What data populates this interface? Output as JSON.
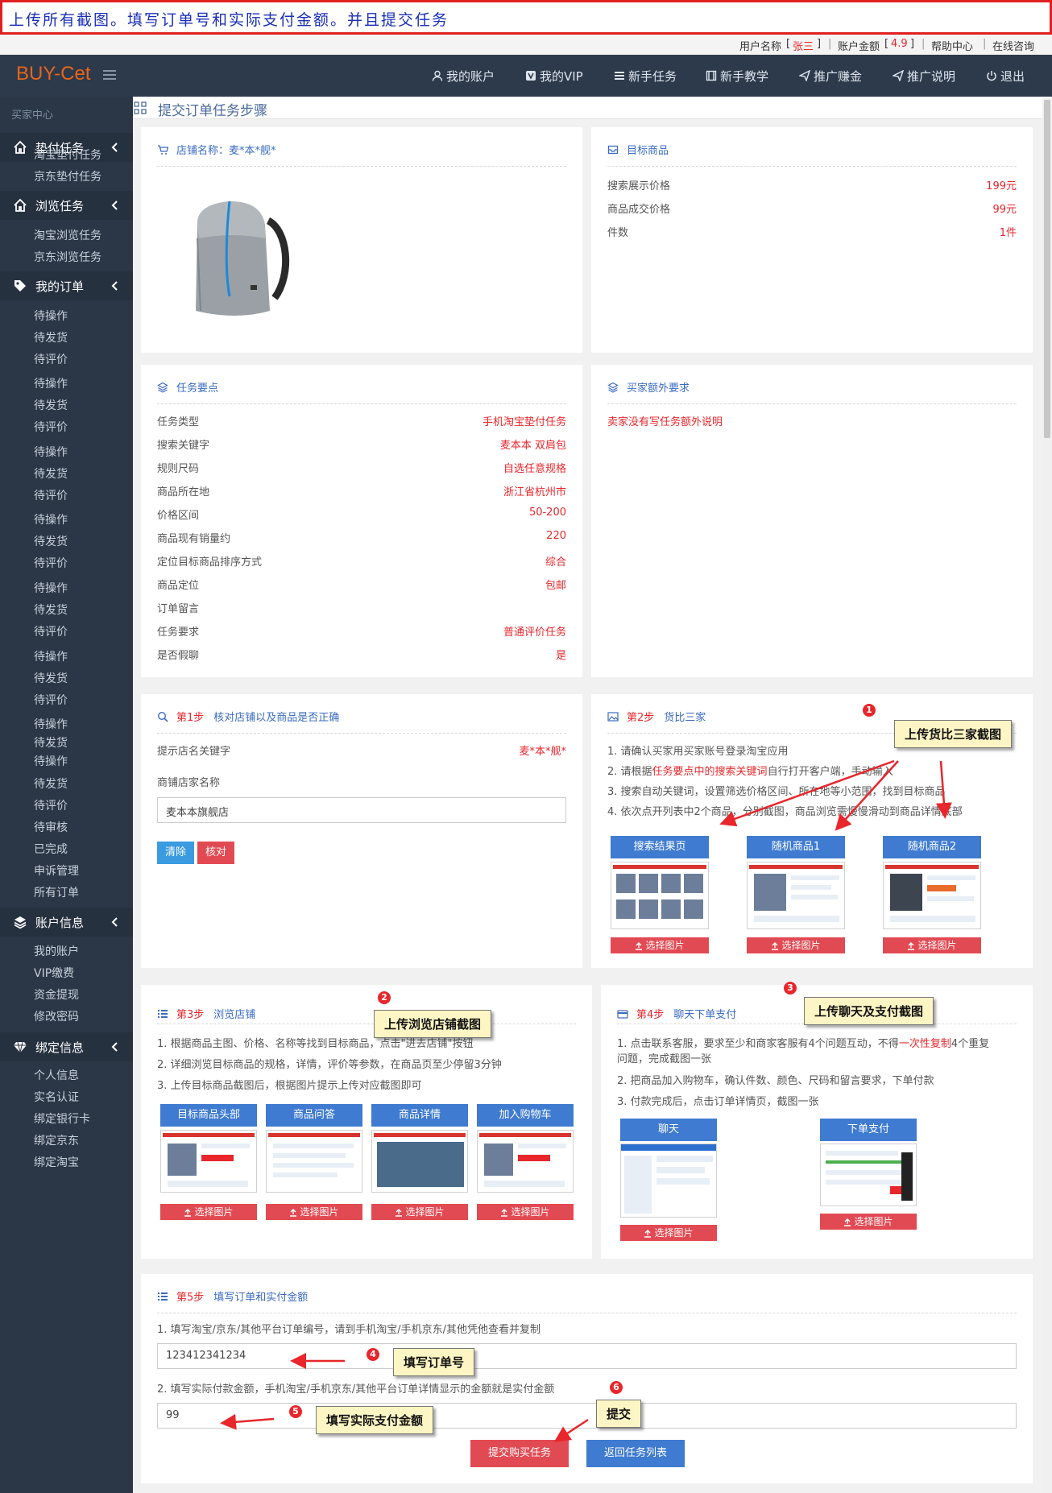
{
  "banner": {
    "text": "上传所有截图。填写订单号和实际支付金额。并且提交任务"
  },
  "userbar": {
    "name_label": "用户名称",
    "name_open": "[",
    "name_value": "张三",
    "name_close": "]",
    "sep": "|",
    "balance_label": "账户金额",
    "balance_open": "[",
    "balance_value": "4.9",
    "balance_close": "]",
    "help": "帮助中心",
    "consult": "在线咨询"
  },
  "topnav": {
    "logo": "BUY-Cet",
    "items": [
      {
        "label": "我的账户",
        "icon": "user-icon"
      },
      {
        "label": "我的VIP",
        "icon": "vip-icon"
      },
      {
        "label": "新手任务",
        "icon": "list-icon"
      },
      {
        "label": "新手教学",
        "icon": "book-icon"
      },
      {
        "label": "推广赚金",
        "icon": "send-icon"
      },
      {
        "label": "推广说明",
        "icon": "send-icon"
      },
      {
        "label": "退出",
        "icon": "power-icon"
      }
    ]
  },
  "sidebar": {
    "header": "买家中心",
    "groups": [
      {
        "label": "垫付任务",
        "icon": "home-icon"
      },
      {
        "label": "浏览任务",
        "icon": "home-icon"
      },
      {
        "label": "我的订单",
        "icon": "tag-icon"
      },
      {
        "label": "账户信息",
        "icon": "layers-icon"
      },
      {
        "label": "绑定信息",
        "icon": "diamond-icon"
      }
    ],
    "items": [
      "淘宝垫付任务",
      "京东垫付任务",
      "淘宝浏览任务",
      "京东浏览任务",
      "待操作",
      "待发货",
      "待评价",
      "待操作",
      "待发货",
      "待评价",
      "待操作",
      "待发货",
      "待评价",
      "待操作",
      "待发货",
      "待评价",
      "待操作",
      "待发货",
      "待评价",
      "待操作",
      "待发货",
      "待评价",
      "待操作",
      "待发货",
      "待操作",
      "待发货",
      "待评价",
      "待审核",
      "已完成",
      "申诉管理",
      "所有订单",
      "我的账户",
      "VIP缴费",
      "资金提现",
      "修改密码",
      "个人信息",
      "实名认证",
      "绑定银行卡",
      "绑定京东",
      "绑定淘宝"
    ]
  },
  "breadcrumb": {
    "title": "提交订单任务步骤",
    "icon": "grid-icon"
  },
  "shop": {
    "title": "店铺名称：麦*本*舰*",
    "icon": "cart-icon"
  },
  "target": {
    "title": "目标商品",
    "icon": "inbox-icon",
    "rows": [
      {
        "k": "搜索展示价格",
        "v": "199元"
      },
      {
        "k": "商品成交价格",
        "v": "99元"
      },
      {
        "k": "件数",
        "v": "1件"
      }
    ]
  },
  "essentials": {
    "title": "任务要点",
    "icon": "layers-icon",
    "rows": [
      {
        "k": "任务类型",
        "v": "手机淘宝垫付任务"
      },
      {
        "k": "搜索关键字",
        "v": "麦本本 双肩包"
      },
      {
        "k": "规则尺码",
        "v": "自选任意规格"
      },
      {
        "k": "商品所在地",
        "v": "浙江省杭州市"
      },
      {
        "k": "价格区间",
        "v": "50-200"
      },
      {
        "k": "商品现有销量约",
        "v": "220"
      },
      {
        "k": "定位目标商品排序方式",
        "v": "综合"
      },
      {
        "k": "商品定位",
        "v": "包邮"
      },
      {
        "k": "订单留言",
        "v": ""
      },
      {
        "k": "任务要求",
        "v": "普通评价任务"
      },
      {
        "k": "是否假聊",
        "v": "是"
      }
    ]
  },
  "extra": {
    "title": "买家额外要求",
    "icon": "layers-icon",
    "text": "卖家没有写任务额外说明"
  },
  "step1": {
    "step": "第1步",
    "title": "核对店铺以及商品是否正确",
    "icon": "search-icon",
    "hint_label": "提示店名关键字",
    "hint_value": "麦*本*舰*",
    "shop_label": "商铺店家名称",
    "shop_value": "麦本本旗舰店",
    "clear": "清除",
    "verify": "核对"
  },
  "step2": {
    "step": "第2步",
    "title": "货比三家",
    "icon": "image-icon",
    "lines": [
      {
        "a": "1. 请确认买家用买家账号登录淘宝应用",
        "b": "",
        "c": ""
      },
      {
        "a": "2. 请根据",
        "b": "任务要点中的搜索关键词",
        "c": "自行打开客户端，手动输入"
      },
      {
        "a": "3. 搜索自动关键词，设置筛选价格区间、所在地等小范围，找到目标商品",
        "b": "",
        "c": ""
      },
      {
        "a": "4. 依次点开列表中2个商品，分别截图，商品浏览需慢慢滑动到商品详情底部",
        "b": "",
        "c": ""
      }
    ],
    "tabs": [
      "搜索结果页",
      "随机商品1",
      "随机商品2"
    ],
    "upload": "选择图片"
  },
  "step3": {
    "step": "第3步",
    "title": "浏览店铺",
    "icon": "list-icon",
    "lines": [
      "1. 根据商品主图、价格、名称等找到目标商品，点击\"进去店铺\"按钮",
      "2. 详细浏览目标商品的规格，详情，评价等参数，在商品页至少停留3分钟",
      "3. 上传目标商品截图后，根据图片提示上传对应截图即可"
    ],
    "tabs": [
      "目标商品头部",
      "商品问答",
      "商品详情",
      "加入购物车"
    ],
    "upload": "选择图片"
  },
  "step4": {
    "step": "第4步",
    "title": "聊天下单支付",
    "icon": "card-icon",
    "line1a": "1. 点击联系客服，要求至少和商家客服有4个问题互动，不得",
    "line1b": "一次性复制",
    "line1c": "4个重复",
    "line1d": "问题，完成截图一张",
    "line2": "2. 把商品加入购物车，确认件数、颜色、尺码和留言要求，下单付款",
    "line3": "3. 付款完成后，点击订单详情页，截图一张",
    "tabs": [
      "聊天",
      "下单支付"
    ],
    "upload": "选择图片"
  },
  "step5": {
    "step": "第5步",
    "title": "填写订单和实付金额",
    "icon": "list-icon",
    "line1": "1. 填写淘宝/京东/其他平台订单编号，请到手机淘宝/手机京东/其他凭他查看并复制",
    "order_value": "123412341234",
    "line2": "2. 填写实际付款金额，手机淘宝/手机京东/其他平台订单详情显示的金额就是实付金额",
    "amount_value": "99",
    "submit": "提交购买任务",
    "back": "返回任务列表"
  },
  "callouts": {
    "c1": "上传货比三家截图",
    "c2": "上传浏览店铺截图",
    "c3": "上传聊天及支付截图",
    "c4": "填写订单号",
    "c5": "填写实际支付金额",
    "c6": "提交",
    "n1": "1",
    "n2": "2",
    "n3": "3",
    "n4": "4",
    "n5": "5",
    "n6": "6"
  },
  "colors": {
    "accent": "#3f7bd0",
    "danger": "#e8262b",
    "sidebar": "#2b3746",
    "nav": "#2d3a4b",
    "logo": "#e8641a",
    "callout": "#fdf6c4"
  }
}
